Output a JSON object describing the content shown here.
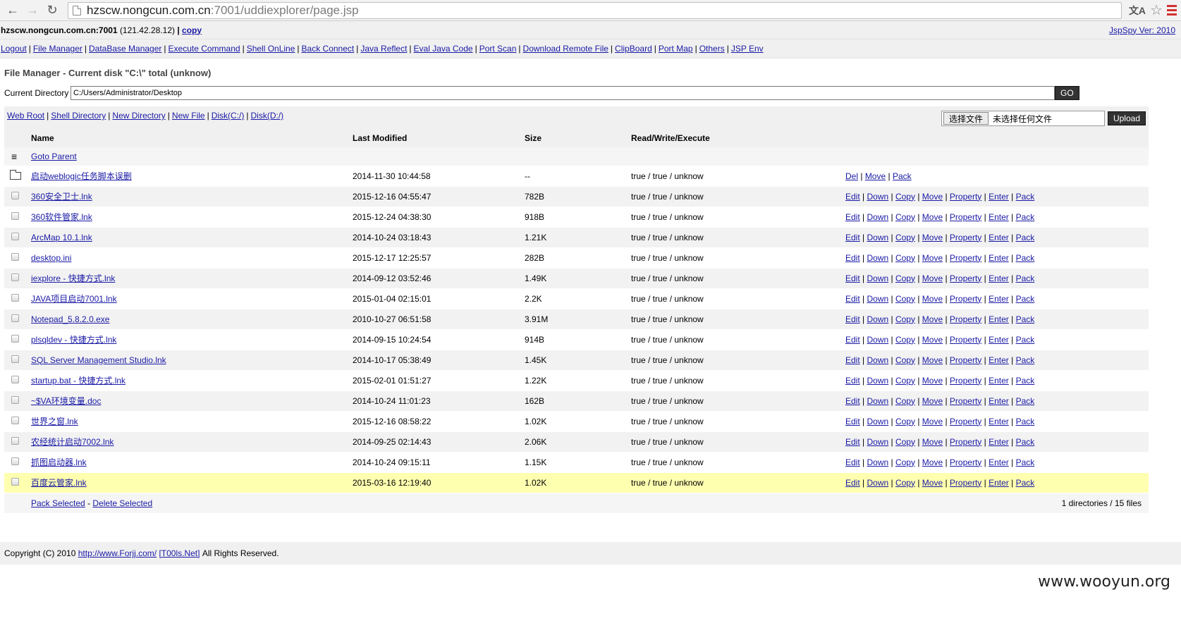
{
  "browser": {
    "url_host": "hzscw.nongcun.com.cn",
    "url_rest": ":7001/uddiexplorer/page.jsp"
  },
  "host": {
    "name": "hzscw.nongcun.com.cn:7001",
    "ip": "(121.42.28.12)",
    "copy": "copy",
    "version": "JspSpy Ver: 2010"
  },
  "nav": [
    "Logout",
    "File Manager",
    "DataBase Manager",
    "Execute Command",
    "Shell OnLine",
    "Back Connect",
    "Java Reflect",
    "Eval Java Code",
    "Port Scan",
    "Download Remote File",
    "ClipBoard",
    "Port Map",
    "Others",
    "JSP Env"
  ],
  "fm": {
    "title": "File Manager - Current disk \"C:\\\" total (unknow)",
    "cd_label": "Current Directory",
    "cd_value": "C:/Users/Administrator/Desktop",
    "go": "GO"
  },
  "quick_links": [
    "Web Root",
    "Shell Directory",
    "New Directory",
    "New File",
    "Disk(C:/)",
    "Disk(D:/)"
  ],
  "upload": {
    "choose": "选择文件",
    "none": "未选择任何文件",
    "button": "Upload"
  },
  "table": {
    "headers": [
      "Name",
      "Last Modified",
      "Size",
      "Read/Write/Execute"
    ],
    "goto_parent": "Goto Parent",
    "folder": {
      "name": "启动weblogic任务脚本误删",
      "modified": "2014-11-30 10:44:58",
      "size": "--",
      "rwx": "true / true / unknow",
      "ops": [
        "Del",
        "Move",
        "Pack"
      ]
    },
    "file_ops": [
      "Edit",
      "Down",
      "Copy",
      "Move",
      "Property",
      "Enter",
      "Pack"
    ],
    "files": [
      {
        "name": "360安全卫士.lnk",
        "modified": "2015-12-16 04:55:47",
        "size": "782B",
        "rwx": "true / true / unknow"
      },
      {
        "name": "360软件管家.lnk",
        "modified": "2015-12-24 04:38:30",
        "size": "918B",
        "rwx": "true / true / unknow"
      },
      {
        "name": "ArcMap 10.1.lnk",
        "modified": "2014-10-24 03:18:43",
        "size": "1.21K",
        "rwx": "true / true / unknow"
      },
      {
        "name": "desktop.ini",
        "modified": "2015-12-17 12:25:57",
        "size": "282B",
        "rwx": "true / true / unknow"
      },
      {
        "name": "iexplore - 快捷方式.lnk",
        "modified": "2014-09-12 03:52:46",
        "size": "1.49K",
        "rwx": "true / true / unknow"
      },
      {
        "name": "JAVA项目启动7001.lnk",
        "modified": "2015-01-04 02:15:01",
        "size": "2.2K",
        "rwx": "true / true / unknow"
      },
      {
        "name": "Notepad_5.8.2.0.exe",
        "modified": "2010-10-27 06:51:58",
        "size": "3.91M",
        "rwx": "true / true / unknow"
      },
      {
        "name": "plsqldev - 快捷方式.lnk",
        "modified": "2014-09-15 10:24:54",
        "size": "914B",
        "rwx": "true / true / unknow"
      },
      {
        "name": "SQL Server Management Studio.lnk",
        "modified": "2014-10-17 05:38:49",
        "size": "1.45K",
        "rwx": "true / true / unknow"
      },
      {
        "name": "startup.bat - 快捷方式.lnk",
        "modified": "2015-02-01 01:51:27",
        "size": "1.22K",
        "rwx": "true / true / unknow"
      },
      {
        "name": "~$VA环境变量.doc",
        "modified": "2014-10-24 11:01:23",
        "size": "162B",
        "rwx": "true / true / unknow"
      },
      {
        "name": "世界之窗.lnk",
        "modified": "2015-12-16 08:58:22",
        "size": "1.02K",
        "rwx": "true / true / unknow"
      },
      {
        "name": "农经统计启动7002.lnk",
        "modified": "2014-09-25 02:14:43",
        "size": "2.06K",
        "rwx": "true / true / unknow"
      },
      {
        "name": "抓图启动器.lnk",
        "modified": "2014-10-24 09:15:11",
        "size": "1.15K",
        "rwx": "true / true / unknow"
      },
      {
        "name": "百度云管家.lnk",
        "modified": "2015-03-16 12:19:40",
        "size": "1.02K",
        "rwx": "true / true / unknow",
        "highlight": true
      }
    ],
    "footer": {
      "pack_selected": "Pack Selected",
      "dash": "-",
      "delete_selected": "Delete Selected",
      "summary": "1 directories / 15 files"
    }
  },
  "copyright": {
    "prefix": "Copyright (C) 2010",
    "link1": "http://www.Forjj.com/",
    "link2": "[T00ls.Net]",
    "suffix": "All Rights Reserved."
  },
  "watermark": "www.wooyun.org",
  "colors": {
    "link": "#1a1aa6",
    "highlight_row": "#ffffb0",
    "alt_row": "#f2f2f2"
  }
}
